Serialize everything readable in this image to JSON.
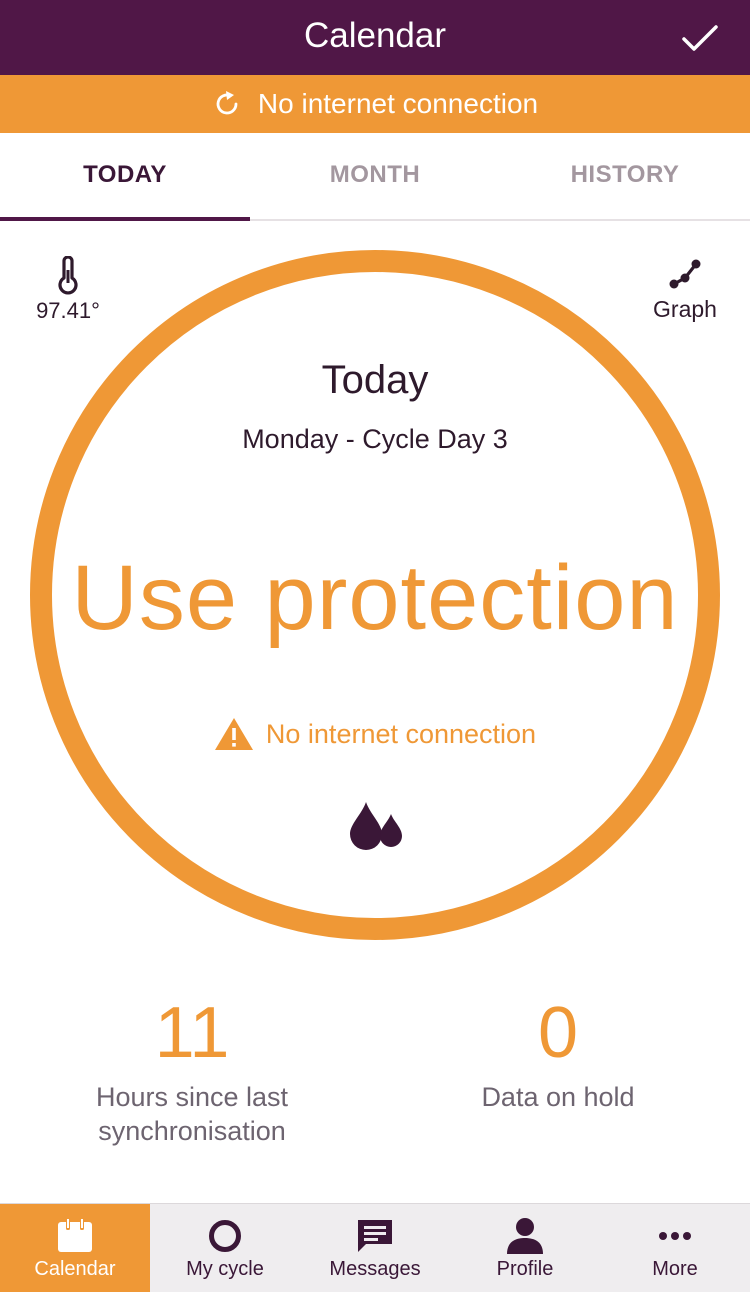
{
  "header": {
    "title": "Calendar",
    "confirm_icon": "checkmark-icon"
  },
  "banner": {
    "text": "No internet connection",
    "icon": "refresh-icon"
  },
  "tabs": [
    {
      "label": "TODAY",
      "active": true
    },
    {
      "label": "MONTH",
      "active": false
    },
    {
      "label": "HISTORY",
      "active": false
    }
  ],
  "temperature": {
    "value": "97.41°",
    "icon": "thermometer-icon"
  },
  "graph": {
    "label": "Graph",
    "icon": "graph-icon"
  },
  "day": {
    "title": "Today",
    "subtitle": "Monday - Cycle Day 3",
    "status": "Use protection",
    "warning": "No internet connection",
    "warning_icon": "warning-icon",
    "flow_icon": "drops-icon"
  },
  "stats": {
    "hours": {
      "value": "11",
      "label_line1": "Hours since last",
      "label_line2": "synchronisation"
    },
    "hold": {
      "value": "0",
      "label": "Data on hold"
    }
  },
  "nav": [
    {
      "label": "Calendar",
      "icon": "calendar-icon",
      "active": true
    },
    {
      "label": "My cycle",
      "icon": "cycle-ring-icon",
      "active": false
    },
    {
      "label": "Messages",
      "icon": "messages-icon",
      "active": false
    },
    {
      "label": "Profile",
      "icon": "profile-icon",
      "active": false
    },
    {
      "label": "More",
      "icon": "more-icon",
      "active": false
    }
  ],
  "colors": {
    "primary": "#501747",
    "accent": "#ef9836",
    "dark_text": "#2e1a2c",
    "muted_tab": "#a3979f"
  }
}
